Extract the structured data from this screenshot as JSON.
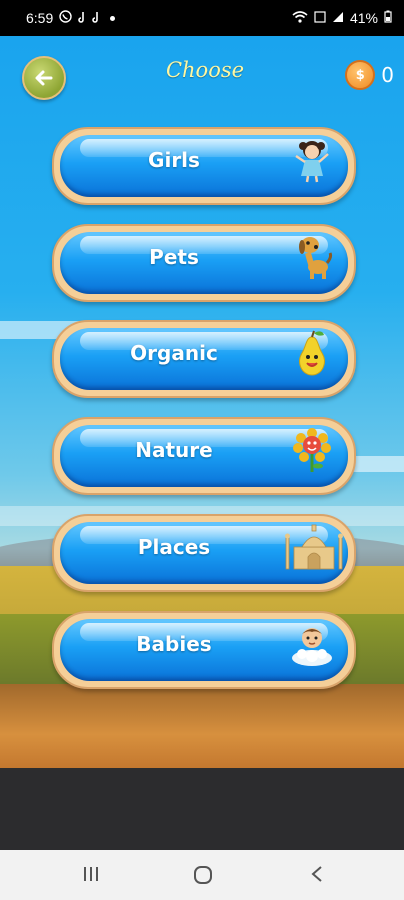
{
  "status_bar": {
    "time": "6:59",
    "battery": "41%"
  },
  "header": {
    "title": "Choose",
    "coin_count": "0",
    "coin_symbol": "$"
  },
  "categories": [
    {
      "label": "Girls",
      "icon": "girl-icon"
    },
    {
      "label": "Pets",
      "icon": "dog-icon"
    },
    {
      "label": "Organic",
      "icon": "pear-icon"
    },
    {
      "label": "Nature",
      "icon": "flower-icon"
    },
    {
      "label": "Places",
      "icon": "taj-mahal-icon"
    },
    {
      "label": "Babies",
      "icon": "baby-icon"
    }
  ],
  "colors": {
    "button_blue": "#1aa0f5",
    "button_border": "#f5cf98",
    "title_yellow": "#fff6a0"
  }
}
